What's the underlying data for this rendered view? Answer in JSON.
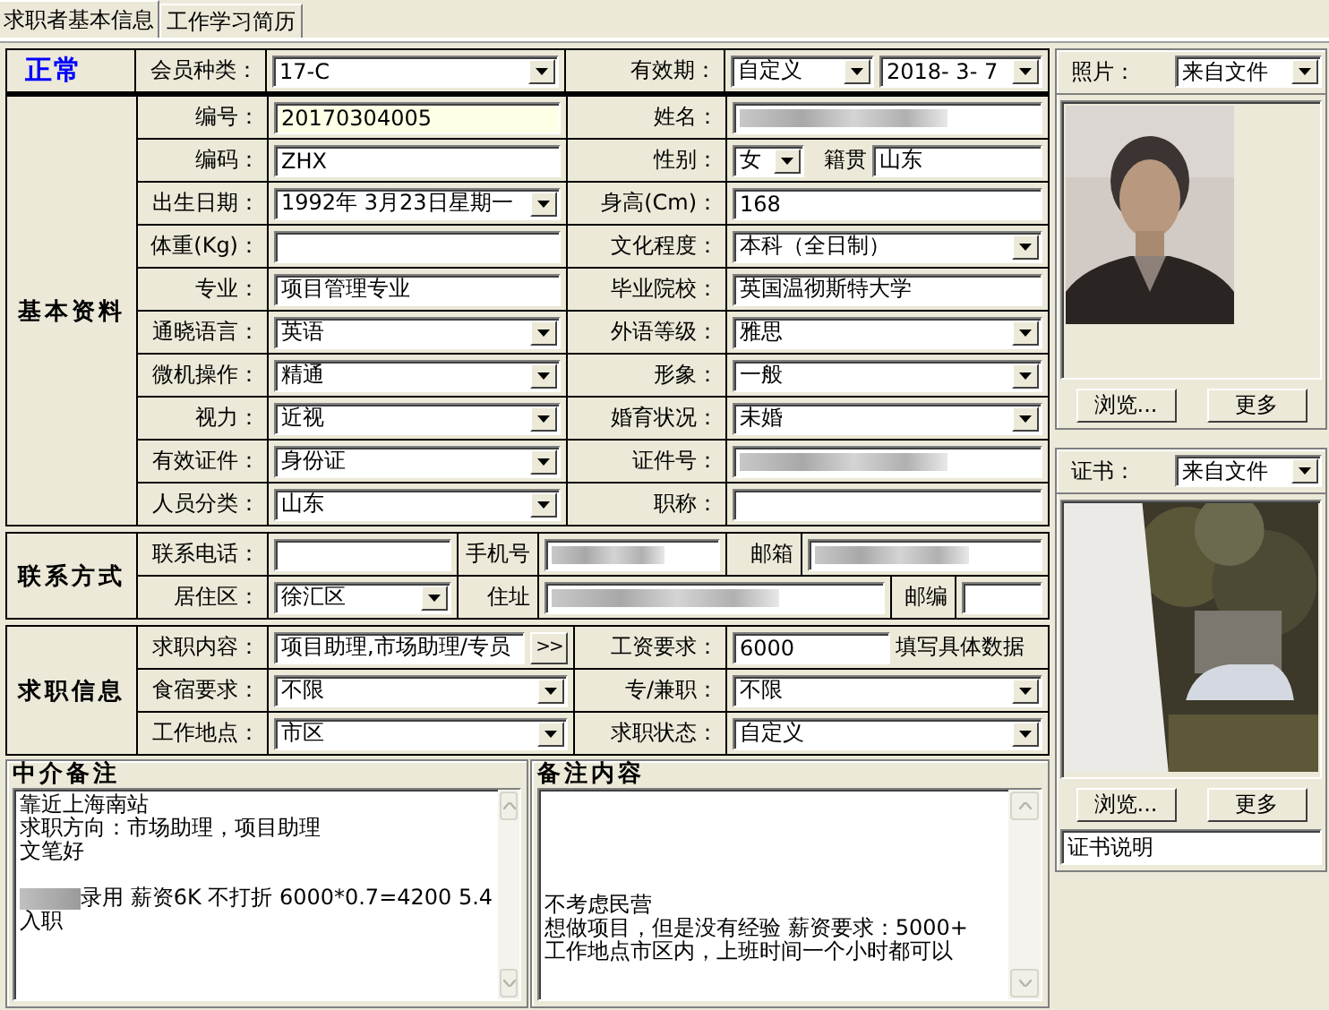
{
  "tabs": [
    {
      "label": "求职者基本信息",
      "selected": true
    },
    {
      "label": "工作学习简历",
      "selected": false
    }
  ],
  "header": {
    "status": "正常",
    "cells": [
      {
        "kind": "label",
        "text": "会员种类："
      },
      {
        "kind": "dropdown",
        "value": "17-C"
      },
      {
        "kind": "label",
        "text": "有效期："
      },
      {
        "kind": "date_pair",
        "mode": "自定义",
        "date": "2018- 3- 7"
      }
    ]
  },
  "basic": {
    "title": "基本资料",
    "rows": [
      [
        {
          "kind": "label",
          "text": "编号："
        },
        {
          "kind": "text",
          "value": "20170304005",
          "focused": true
        },
        {
          "kind": "label",
          "text": "姓名："
        },
        {
          "kind": "redacted"
        }
      ],
      [
        {
          "kind": "label",
          "text": "编码："
        },
        {
          "kind": "text",
          "value": "ZHX"
        },
        {
          "kind": "label",
          "text": "性别："
        },
        {
          "kind": "sex",
          "value": "女",
          "label2": "籍贯",
          "value2": "山东"
        }
      ],
      [
        {
          "kind": "label",
          "text": "出生日期："
        },
        {
          "kind": "dropdown",
          "value": "1992年 3月23日星期一"
        },
        {
          "kind": "label",
          "text": "身高(Cm)："
        },
        {
          "kind": "text",
          "value": "168"
        }
      ],
      [
        {
          "kind": "label",
          "text": "体重(Kg)："
        },
        {
          "kind": "text"
        },
        {
          "kind": "label",
          "text": "文化程度："
        },
        {
          "kind": "dropdown",
          "value": "本科（全日制）"
        }
      ],
      [
        {
          "kind": "label",
          "text": "专业："
        },
        {
          "kind": "text",
          "value": "项目管理专业"
        },
        {
          "kind": "label",
          "text": "毕业院校："
        },
        {
          "kind": "text",
          "value": "英国温彻斯特大学"
        }
      ],
      [
        {
          "kind": "label",
          "text": "通晓语言："
        },
        {
          "kind": "dropdown",
          "value": "英语"
        },
        {
          "kind": "label",
          "text": "外语等级："
        },
        {
          "kind": "dropdown",
          "value": "雅思"
        }
      ],
      [
        {
          "kind": "label",
          "text": "微机操作："
        },
        {
          "kind": "dropdown",
          "value": "精通"
        },
        {
          "kind": "label",
          "text": "形象："
        },
        {
          "kind": "dropdown",
          "value": "一般"
        }
      ],
      [
        {
          "kind": "label",
          "text": "视力："
        },
        {
          "kind": "dropdown",
          "value": "近视"
        },
        {
          "kind": "label",
          "text": "婚育状况："
        },
        {
          "kind": "dropdown",
          "value": "未婚"
        }
      ],
      [
        {
          "kind": "label",
          "text": "有效证件："
        },
        {
          "kind": "dropdown",
          "value": "身份证"
        },
        {
          "kind": "label",
          "text": "证件号："
        },
        {
          "kind": "redacted"
        }
      ],
      [
        {
          "kind": "label",
          "text": "人员分类："
        },
        {
          "kind": "dropdown",
          "value": "山东"
        },
        {
          "kind": "label",
          "text": "职称："
        },
        {
          "kind": "text"
        }
      ]
    ]
  },
  "contact": {
    "title": "联系方式",
    "rows": [
      [
        {
          "kind": "label",
          "text": "联系电话："
        },
        {
          "kind": "text"
        },
        {
          "kind": "label",
          "text": "手机号"
        },
        {
          "kind": "redacted"
        },
        {
          "kind": "label",
          "text": "邮箱"
        },
        {
          "kind": "redacted"
        }
      ],
      [
        {
          "kind": "label",
          "text": "居住区："
        },
        {
          "kind": "dropdown",
          "value": "徐汇区"
        },
        {
          "kind": "label",
          "text": "住址"
        },
        {
          "kind": "redacted"
        },
        {
          "kind": "label",
          "text": "邮编"
        },
        {
          "kind": "text"
        }
      ]
    ]
  },
  "job": {
    "title": "求职信息",
    "rows": [
      [
        {
          "kind": "label",
          "text": "求职内容："
        },
        {
          "kind": "text_button",
          "value": "项目助理,市场助理/专员",
          "button": ">>"
        },
        {
          "kind": "label",
          "text": "工资要求："
        },
        {
          "kind": "text_hint",
          "value": "6000",
          "hint": "填写具体数据"
        }
      ],
      [
        {
          "kind": "label",
          "text": "食宿要求："
        },
        {
          "kind": "dropdown",
          "value": "不限"
        },
        {
          "kind": "label",
          "text": "专/兼职："
        },
        {
          "kind": "dropdown",
          "value": "不限"
        }
      ],
      [
        {
          "kind": "label",
          "text": "工作地点："
        },
        {
          "kind": "dropdown",
          "value": "市区"
        },
        {
          "kind": "label",
          "text": "求职状态："
        },
        {
          "kind": "dropdown",
          "value": "自定义"
        }
      ]
    ]
  },
  "notes": [
    {
      "title": "中介备注",
      "lines": [
        {
          "text": "靠近上海南站"
        },
        {
          "text": "求职方向：市场助理，项目助理"
        },
        {
          "text": "文笔好"
        },
        {
          "text": "录用 薪资6K 不打折  6000*0.7=4200  5.4",
          "blank_before": true,
          "redacted_prefix": true
        },
        {
          "text": "入职"
        }
      ]
    },
    {
      "title": "备注内容",
      "lines": [
        {
          "text": "不考虑民营"
        },
        {
          "text": "想做项目，但是没有经验  薪资要求：5000+"
        },
        {
          "text": "工作地点市区内，上班时间一个小时都可以"
        }
      ]
    }
  ],
  "photo": {
    "label": "照片：",
    "source": "来自文件",
    "buttons": [
      "浏览...",
      "更多"
    ]
  },
  "certificate": {
    "label": "证书：",
    "source": "来自文件",
    "buttons": [
      "浏览...",
      "更多"
    ],
    "caption": "证书说明"
  }
}
